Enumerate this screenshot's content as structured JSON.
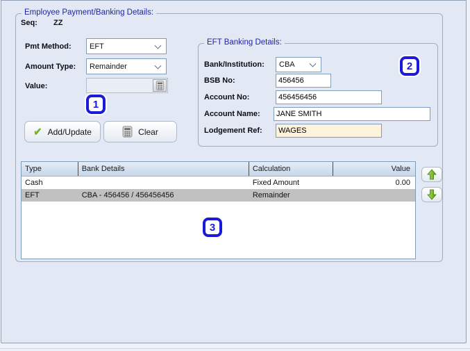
{
  "groups": {
    "employee": {
      "title": "Employee Payment/Banking Details:"
    },
    "eft": {
      "title": "EFT Banking Details:"
    }
  },
  "form": {
    "seq_label": "Seq:",
    "seq_value": "ZZ",
    "pmt_method_label": "Pmt Method:",
    "pmt_method_value": "EFT",
    "amount_type_label": "Amount Type:",
    "amount_type_value": "Remainder",
    "value_label": "Value:",
    "value_value": ""
  },
  "buttons": {
    "add_update": "Add/Update",
    "clear": "Clear"
  },
  "eft_form": {
    "bank_label": "Bank/Institution:",
    "bank_value": "CBA",
    "bsb_label": "BSB No:",
    "bsb_value": "456456",
    "account_no_label": "Account No:",
    "account_no_value": "456456456",
    "account_name_label": "Account Name:",
    "account_name_value": "JANE SMITH",
    "lodgement_label": "Lodgement Ref:",
    "lodgement_value": "WAGES"
  },
  "badges": {
    "one": "1",
    "two": "2",
    "three": "3"
  },
  "table": {
    "columns": [
      "Type",
      "Bank Details",
      "Calculation",
      "Value"
    ],
    "rows": [
      {
        "type": "Cash",
        "bank_details": "",
        "calculation": "Fixed Amount",
        "value": "0.00"
      },
      {
        "type": "EFT",
        "bank_details": "CBA - 456456 / 456456456",
        "calculation": "Remainder",
        "value": ""
      }
    ]
  },
  "icons": {
    "add_update": "check-icon",
    "clear": "calculator-icon",
    "value_field": "calculator-icon",
    "move_up": "arrow-up-icon",
    "move_down": "arrow-down-icon"
  },
  "colors": {
    "title_blue": "#2222aa",
    "badge_blue": "#1a1ad8",
    "selected_row": "#c1c1c1",
    "lodgement_bg": "#fbf3dc",
    "check_green": "#82bb29",
    "arrow_green": "#5ea617",
    "panel_bg": "#e2e9f4"
  }
}
